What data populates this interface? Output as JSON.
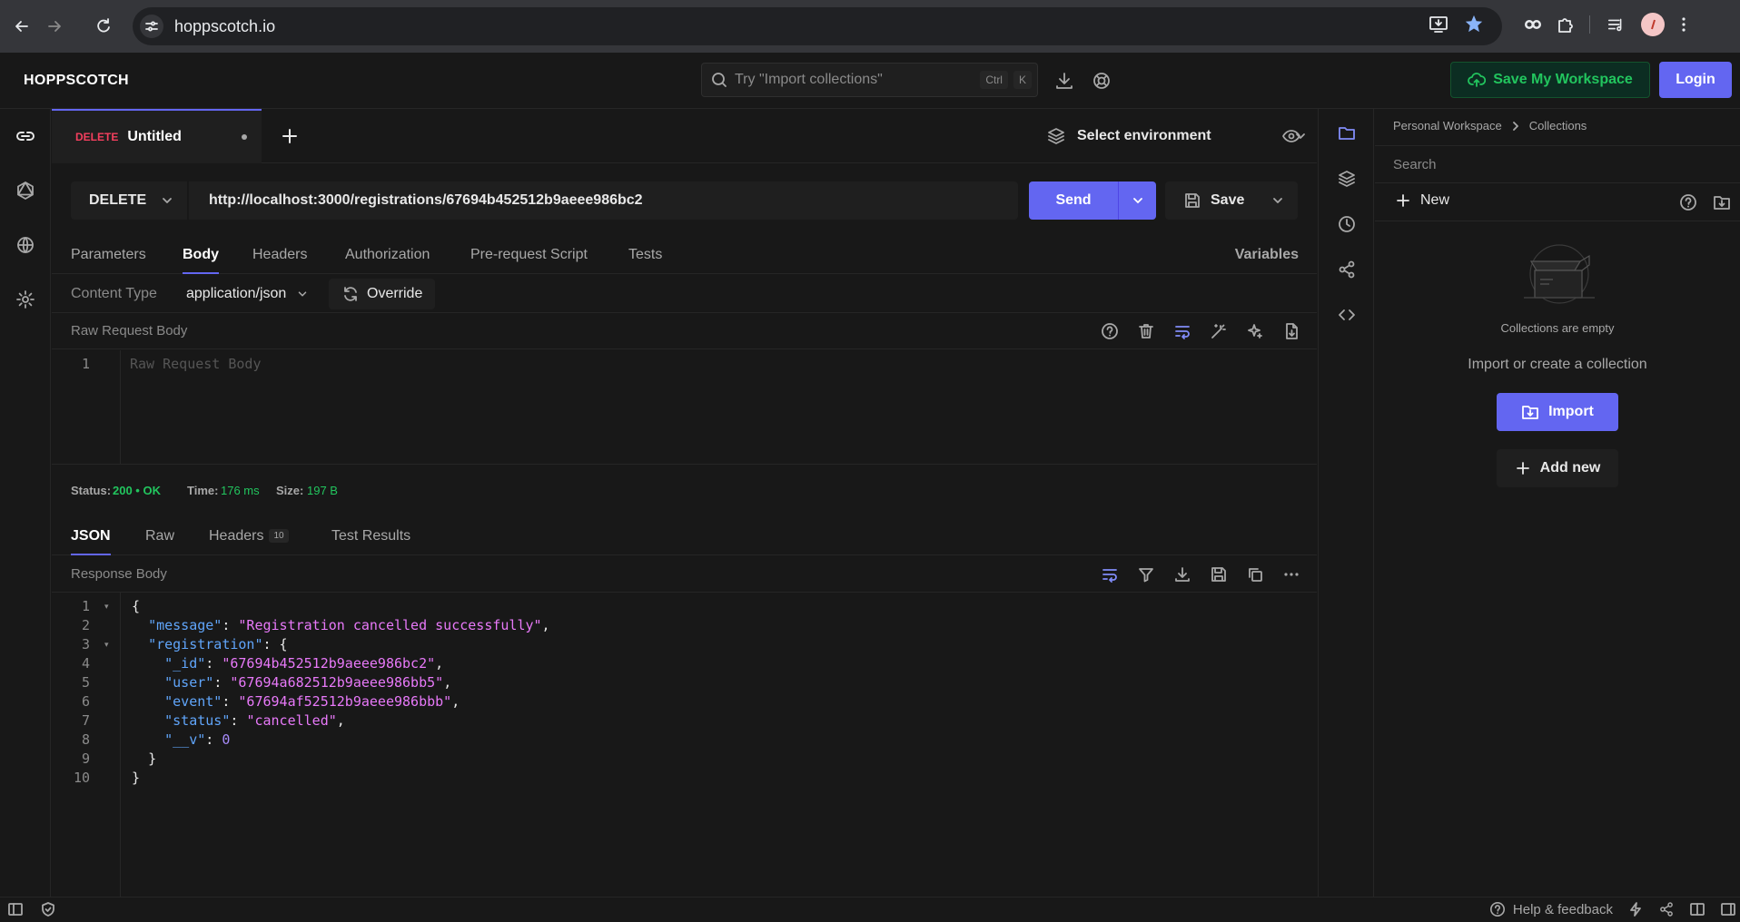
{
  "browser": {
    "url": "hoppscotch.io",
    "icons": [
      "back-icon",
      "forward-icon",
      "reload-icon",
      "site-settings-icon",
      "install-icon",
      "star-icon",
      "extension-icon",
      "puzzle-icon",
      "media-icon",
      "profile-avatar"
    ]
  },
  "app": {
    "brand": "HOPPSCOTCH",
    "search_placeholder": "Try \"Import collections\"",
    "search_kbd": [
      "Ctrl",
      "K"
    ],
    "save_workspace_label": "Save My Workspace",
    "login_label": "Login"
  },
  "tabs": [
    {
      "method": "DELETE",
      "title": "Untitled"
    }
  ],
  "environment": {
    "label": "Select environment"
  },
  "request": {
    "method": "DELETE",
    "url": "http://localhost:3000/registrations/67694b452512b9aeee986bc2",
    "send_label": "Send",
    "save_label": "Save"
  },
  "request_tabs": [
    "Parameters",
    "Body",
    "Headers",
    "Authorization",
    "Pre-request Script",
    "Tests"
  ],
  "variables_label": "Variables",
  "content_type": {
    "label": "Content Type",
    "value": "application/json",
    "override_label": "Override"
  },
  "raw_body": {
    "label": "Raw Request Body",
    "placeholder": "Raw Request Body",
    "line": "1"
  },
  "status": {
    "status_label": "Status:",
    "status_value": "200 • OK",
    "time_label": "Time:",
    "time_value": "176 ms",
    "size_label": "Size:",
    "size_value": "197 B"
  },
  "response_tabs": {
    "json": "JSON",
    "raw": "Raw",
    "headers": "Headers",
    "headers_count": "10",
    "tests": "Test Results"
  },
  "response_body_label": "Response Body",
  "response_lines": [
    {
      "n": "1",
      "text": "{"
    },
    {
      "n": "2",
      "key": "\"message\"",
      "val": "\"Registration cancelled successfully\"",
      "tail": ","
    },
    {
      "n": "3",
      "key": "\"registration\"",
      "tail": ": {"
    },
    {
      "n": "4",
      "key": "\"_id\"",
      "val": "\"67694b452512b9aeee986bc2\"",
      "tail": ","
    },
    {
      "n": "5",
      "key": "\"user\"",
      "val": "\"67694a682512b9aeee986bb5\"",
      "tail": ","
    },
    {
      "n": "6",
      "key": "\"event\"",
      "val": "\"67694af52512b9aeee986bbb\"",
      "tail": ","
    },
    {
      "n": "7",
      "key": "\"status\"",
      "val": "\"cancelled\"",
      "tail": ","
    },
    {
      "n": "8",
      "key": "\"__v\"",
      "num": "0"
    },
    {
      "n": "9",
      "text": "}"
    },
    {
      "n": "10",
      "text": "}"
    }
  ],
  "collections": {
    "crumb_root": "Personal Workspace",
    "crumb_leaf": "Collections",
    "search_placeholder": "Search",
    "new_label": "New",
    "empty_label": "Collections are empty",
    "import_prompt": "Import or create a collection",
    "import_label": "Import",
    "add_new_label": "Add new"
  },
  "footer": {
    "help_label": "Help & feedback"
  },
  "colors": {
    "accent": "#6366f1",
    "success": "#22c55e",
    "delete_method": "#f43f5e",
    "json_key": "#60a5fa",
    "json_string": "#e879f9"
  }
}
